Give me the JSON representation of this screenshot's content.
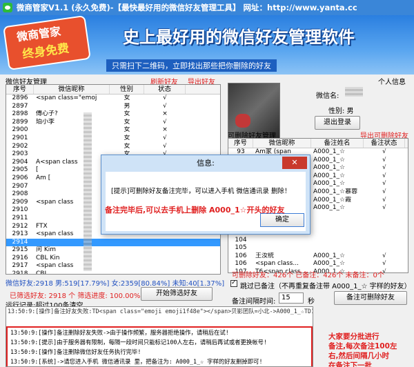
{
  "titlebar": {
    "text": "微商管家V1.1 (永久免费)-【最快最好用的微信好友管理工具】 网址：http://www.yanta.cc"
  },
  "banner": {
    "badge_line1": "微商管家",
    "badge_line2": "终身免费",
    "headline": "史上最好用的微信好友管理软件",
    "subline": "只需扫下二维码，立即找出那些把你删除的好友"
  },
  "left_panel": {
    "title": "微信好友管理",
    "link_refresh": "刷新好友",
    "link_export": "导出好友",
    "columns": [
      "序号",
      "微信昵称",
      "性别",
      "状态"
    ],
    "rows": [
      {
        "no": "2896",
        "nick": "<span class=\"emoj",
        "sex": "女",
        "status": "√"
      },
      {
        "no": "2897",
        "nick": "",
        "sex": "男",
        "status": "√"
      },
      {
        "no": "2898",
        "nick": "傅心子?",
        "sex": "女",
        "status": "×"
      },
      {
        "no": "2899",
        "nick": "珀小李",
        "sex": "女",
        "status": "√"
      },
      {
        "no": "2900",
        "nick": "",
        "sex": "女",
        "status": "×"
      },
      {
        "no": "2901",
        "nick": "",
        "sex": "女",
        "status": "√"
      },
      {
        "no": "2902",
        "nick": "",
        "sex": "女",
        "status": "√"
      },
      {
        "no": "2903",
        "nick": "",
        "sex": "女",
        "status": "√"
      },
      {
        "no": "2904",
        "nick": "A<span class",
        "sex": "男",
        "status": "√"
      },
      {
        "no": "2905",
        "nick": "[",
        "sex": "",
        "status": "√"
      },
      {
        "no": "2906",
        "nick": "Am [",
        "sex": "",
        "status": "√"
      },
      {
        "no": "2907",
        "nick": "",
        "sex": "",
        "status": ""
      },
      {
        "no": "2908",
        "nick": "",
        "sex": "",
        "status": ""
      },
      {
        "no": "2909",
        "nick": "<span class",
        "sex": "",
        "status": ""
      },
      {
        "no": "2910",
        "nick": "",
        "sex": "",
        "status": ""
      },
      {
        "no": "2911",
        "nick": "",
        "sex": "",
        "status": ""
      },
      {
        "no": "2912",
        "nick": "FTX",
        "sex": "",
        "status": ""
      },
      {
        "no": "2913",
        "nick": "<span class",
        "sex": "",
        "status": ""
      },
      {
        "no": "2914",
        "nick": "",
        "sex": "",
        "status": ""
      },
      {
        "no": "2915",
        "nick": "问 Kim",
        "sex": "",
        "status": ""
      },
      {
        "no": "2916",
        "nick": "CBL Kin",
        "sex": "",
        "status": ""
      },
      {
        "no": "2917",
        "nick": "<span class",
        "sex": "",
        "status": ""
      },
      {
        "no": "2918",
        "nick": "CBL",
        "sex": "",
        "status": ""
      }
    ],
    "selected_index": 18,
    "stats_line": "微信好友:2918  男:519[17.79%]  女:2359[80.84%]  未知:40[1.37%]",
    "deleted_line": "已筛选好友: 2918 个  筛选进度: 100.00%",
    "filter_button": "开始筛选好友"
  },
  "right_panel": {
    "personal_info": "个人信息",
    "wechat_name_label": "微信名:",
    "gender_label": "性别: 男",
    "logout_button": "退出登录",
    "deleted_title": "可删除好友管理",
    "export_link": "导出可删除好友",
    "columns": [
      "序号",
      "微信昵称",
      "备注姓名",
      "备注状态"
    ],
    "rows": [
      {
        "no": "93",
        "nick": "Am家 (span",
        "remark": "A000_1_☆",
        "status": "√"
      },
      {
        "no": "94",
        "nick": "",
        "remark": "A000_1_☆",
        "status": "√"
      },
      {
        "no": "95",
        "nick": "",
        "remark": "A000_1_☆",
        "status": "√"
      },
      {
        "no": "96",
        "nick": "",
        "remark": "A000_1_☆",
        "status": "√"
      },
      {
        "no": "97",
        "nick": "",
        "remark": "A000_1_☆",
        "status": "√"
      },
      {
        "no": "98",
        "nick": "",
        "remark": "A000_1_☆慕蓉",
        "status": "√"
      },
      {
        "no": "99",
        "nick": "",
        "remark": "A000_1_☆霞",
        "status": "√"
      },
      {
        "no": "100",
        "nick": "",
        "remark": "A000_1_☆",
        "status": "√"
      },
      {
        "no": "101",
        "nick": "",
        "remark": "",
        "status": ""
      },
      {
        "no": "102",
        "nick": "",
        "remark": "",
        "status": ""
      },
      {
        "no": "103",
        "nick": "",
        "remark": "",
        "status": ""
      },
      {
        "no": "104",
        "nick": "",
        "remark": "",
        "status": ""
      },
      {
        "no": "105",
        "nick": "",
        "remark": "",
        "status": ""
      },
      {
        "no": "106",
        "nick": "王汝统",
        "remark": "A000_1_☆",
        "status": "√"
      },
      {
        "no": "106",
        "nick": "<span class...",
        "remark": "A000_1_☆",
        "status": "√"
      },
      {
        "no": "107",
        "nick": "T6<span class...",
        "remark": "A000_1_☆",
        "status": "√"
      }
    ],
    "stats_line": "可删除好友：426个  已备注：426个  未备注：0个",
    "skip_label": "跳过已备注（不再重复备注带 A000_1_☆ 字样的好友）",
    "interval_label": "备注间隔时间:",
    "interval_value": "15",
    "interval_unit": "秒",
    "remark_button": "备注可删除好友"
  },
  "log": {
    "title": "运行记录:超过100条清空",
    "lines": [
      "13:50:9:[操作]备注删除好友失败->由于操作频繁，服务器拒绝操作，请稍后在试!",
      "13:50:9:[提示]由于服务器有限制，每隔一段时间只能标记100人左右，请稍后再试或者更换帐号!",
      "13:50:9:[操作]备注删除微信好友任务执行完毕!",
      "13:50:9:[系统]->请您进入手机 微信通讯录 里，把备注为: A000_1_☆ 字样的好友删掉即可!"
    ],
    "top_line": "13:50:9:[操作]备注好友失败:TD<span class=\"emoji emoji1f48e\"></span>贝影团队=小北->A000_1_☆TD1f48e贝影团队=小北  进度:426/106     错误次数:5"
  },
  "dialog": {
    "title": "信息:",
    "message": "[提示]可删除好友备注完毕，可以进入手机 微信通讯录 删除！",
    "ok_button": "确定",
    "close_label": "✕"
  },
  "annotations": {
    "dialog_note": "备注完毕后,可以去手机上删除 A000_1☆开头的好友",
    "side_note_l1": "大家要分批进行",
    "side_note_l2": "备注,每次备注100左",
    "side_note_l3": "右,然后间隔几小时",
    "side_note_l4": "在备注下一批"
  }
}
